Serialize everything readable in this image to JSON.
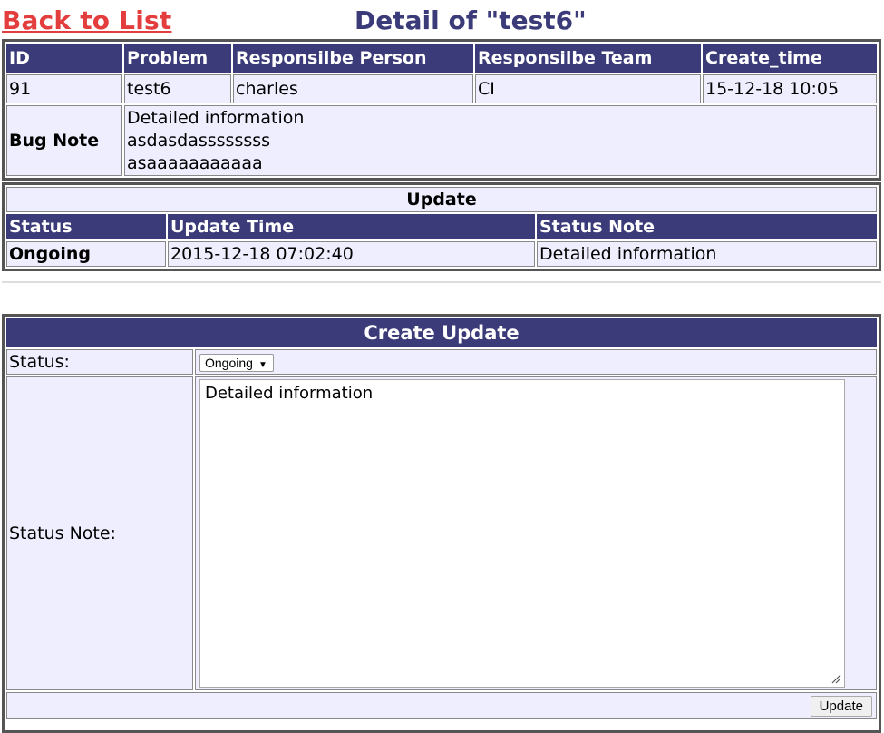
{
  "header": {
    "back_label": "Back to List",
    "title": "Detail of \"test6\""
  },
  "detail": {
    "columns": [
      "ID",
      "Problem",
      "Responsilbe Person",
      "Responsilbe Team",
      "Create_time"
    ],
    "row": [
      "91",
      "test6",
      "charles",
      "CI",
      "15-12-18 10:05"
    ],
    "bug_note_label": "Bug Note",
    "bug_note_lines": [
      "Detailed information",
      "asdasdassssssss",
      "asaaaaaaaaaaa"
    ]
  },
  "update": {
    "title": "Update",
    "columns": [
      "Status",
      "Update Time",
      "Status Note"
    ],
    "row": [
      "Ongoing",
      "2015-12-18 07:02:40",
      "Detailed information"
    ]
  },
  "create": {
    "title": "Create Update",
    "status_label": "Status:",
    "status_value": "Ongoing",
    "note_label": "Status Note:",
    "note_value": "Detailed information",
    "submit_label": "Update"
  },
  "colors": {
    "header_bg": "#3b3b7a",
    "cell_bg": "#eeeeff",
    "link": "#e43d3d"
  }
}
